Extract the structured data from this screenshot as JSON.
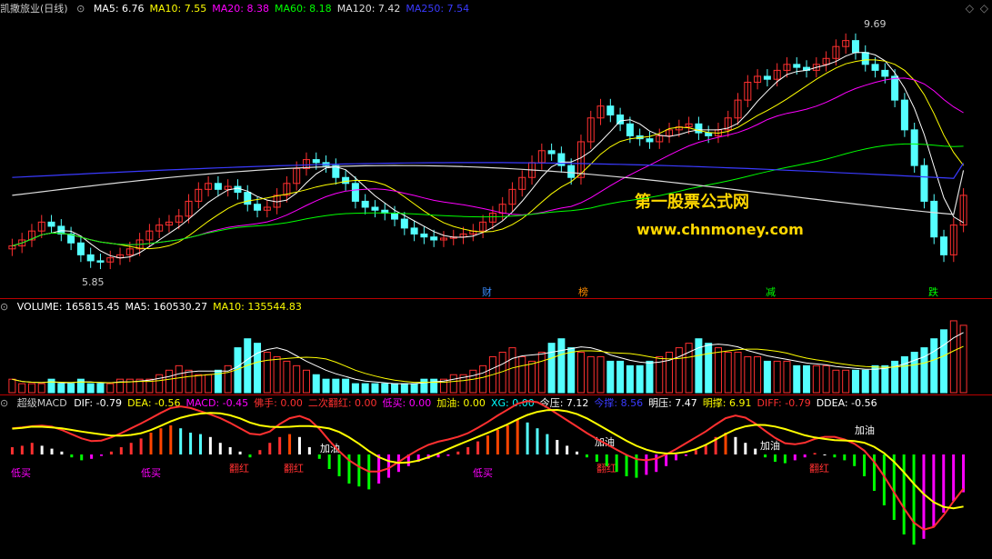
{
  "chart_data": [
    {
      "type": "candlestick",
      "title": "凯撒旅业(日线)",
      "indicators": [
        {
          "name": "MA5",
          "value": "6.76",
          "color": "#ffffff"
        },
        {
          "name": "MA10",
          "value": "7.55",
          "color": "#ffff00"
        },
        {
          "name": "MA20",
          "value": "8.38",
          "color": "#ff00ff"
        },
        {
          "name": "MA60",
          "value": "8.18",
          "color": "#00ff00"
        },
        {
          "name": "MA120",
          "value": "7.42",
          "color": "#dddddd"
        },
        {
          "name": "MA250",
          "value": "7.54",
          "color": "#3a3aff"
        }
      ],
      "high_label": "9.69",
      "low_label": "5.85",
      "event_markers": [
        {
          "text": "财",
          "color": "#3a8cff"
        },
        {
          "text": "榜",
          "color": "#ff8c00"
        },
        {
          "text": "减",
          "color": "#00ff00"
        },
        {
          "text": "跌",
          "color": "#00ff00"
        }
      ],
      "close": [
        6.15,
        6.25,
        6.4,
        6.55,
        6.48,
        6.35,
        6.2,
        6.0,
        5.9,
        5.88,
        5.95,
        6.0,
        6.1,
        6.25,
        6.4,
        6.5,
        6.55,
        6.65,
        6.9,
        7.1,
        7.2,
        7.1,
        7.15,
        7.05,
        6.85,
        6.75,
        6.8,
        7.0,
        7.2,
        7.45,
        7.6,
        7.55,
        7.5,
        7.3,
        7.2,
        6.9,
        6.8,
        6.75,
        6.7,
        6.6,
        6.45,
        6.35,
        6.3,
        6.25,
        6.28,
        6.3,
        6.35,
        6.4,
        6.55,
        6.7,
        6.85,
        7.1,
        7.3,
        7.55,
        7.75,
        7.7,
        7.5,
        7.3,
        7.9,
        8.3,
        8.5,
        8.35,
        8.2,
        8.0,
        7.95,
        7.9,
        8.0,
        8.1,
        8.15,
        8.2,
        8.05,
        8.0,
        8.1,
        8.3,
        8.6,
        8.9,
        9.0,
        8.95,
        9.1,
        9.2,
        9.15,
        9.1,
        9.2,
        9.3,
        9.5,
        9.6,
        9.4,
        9.2,
        9.1,
        9.0,
        8.6,
        8.1,
        7.5,
        6.9,
        6.3,
        6.0,
        6.5,
        7.0
      ]
    },
    {
      "type": "bar",
      "title": "VOLUME",
      "indicators": [
        {
          "name": "VOLUME",
          "value": "165815.45",
          "color": "#ffffff"
        },
        {
          "name": "MA5",
          "value": "160530.27",
          "color": "#ffffff"
        },
        {
          "name": "MA10",
          "value": "135544.83",
          "color": "#ffff00"
        }
      ],
      "values": [
        3,
        2,
        2,
        2,
        3,
        2,
        2,
        3,
        2,
        2,
        2,
        3,
        3,
        3,
        3,
        4,
        5,
        6,
        5,
        4,
        4,
        5,
        6,
        10,
        12,
        11,
        9,
        8,
        7,
        6,
        5,
        4,
        3,
        3,
        3,
        2,
        2,
        2,
        2,
        2,
        2,
        2,
        3,
        3,
        3,
        4,
        4,
        5,
        6,
        8,
        9,
        10,
        8,
        7,
        9,
        11,
        12,
        10,
        9,
        8,
        8,
        7,
        7,
        6,
        6,
        7,
        8,
        9,
        10,
        11,
        12,
        11,
        10,
        9,
        9,
        8,
        8,
        7,
        7,
        7,
        6,
        6,
        6,
        6,
        5,
        5,
        5,
        5,
        6,
        6,
        7,
        8,
        9,
        10,
        12,
        14,
        16,
        15
      ]
    },
    {
      "type": "bar",
      "title": "超级MACD",
      "indicators": [
        {
          "name": "DIF",
          "value": "-0.79",
          "color": "#ffffff"
        },
        {
          "name": "DEA",
          "value": "-0.56",
          "color": "#ffff00"
        },
        {
          "name": "MACD",
          "value": "-0.45",
          "color": "#ff00ff"
        },
        {
          "name": "佛手",
          "value": "0.00",
          "color": "#ff3030"
        },
        {
          "name": "二次翻红",
          "value": "0.00",
          "color": "#ff3030"
        },
        {
          "name": "低买",
          "value": "0.00",
          "color": "#ff00ff"
        },
        {
          "name": "加油",
          "value": "0.00",
          "color": "#ffff00"
        },
        {
          "name": "XG",
          "value": "0.00",
          "color": "#00ffff"
        },
        {
          "name": "今压",
          "value": "7.12",
          "color": "#ffffff"
        },
        {
          "name": "今撑",
          "value": "8.56",
          "color": "#3a3aff"
        },
        {
          "name": "明压",
          "value": "7.47",
          "color": "#ffffff"
        },
        {
          "name": "明撑",
          "value": "6.91",
          "color": "#ffff00"
        },
        {
          "name": "DIFF",
          "value": "-0.79",
          "color": "#ff3030"
        },
        {
          "name": "DDEA",
          "value": "-0.56",
          "color": "#ffffff"
        }
      ],
      "annotations": [
        {
          "text": "低买",
          "color": "#ff00ff"
        },
        {
          "text": "低买",
          "color": "#ff00ff"
        },
        {
          "text": "翻红",
          "color": "#ff3030"
        },
        {
          "text": "翻红",
          "color": "#ff3030"
        },
        {
          "text": "加油",
          "color": "#ffffff"
        },
        {
          "text": "低买",
          "color": "#ff00ff"
        },
        {
          "text": "加油",
          "color": "#ffffff"
        },
        {
          "text": "翻红",
          "color": "#ff3030"
        },
        {
          "text": "加油",
          "color": "#ffffff"
        },
        {
          "text": "翻红",
          "color": "#ff3030"
        },
        {
          "text": "加油",
          "color": "#ffffff"
        }
      ],
      "values": [
        0.05,
        0.06,
        0.08,
        0.06,
        0.04,
        0.02,
        -0.02,
        -0.04,
        -0.03,
        -0.01,
        0.02,
        0.05,
        0.08,
        0.11,
        0.15,
        0.18,
        0.2,
        0.18,
        0.15,
        0.14,
        0.12,
        0.08,
        0.05,
        0.02,
        -0.02,
        0.03,
        0.08,
        0.12,
        0.14,
        0.12,
        0.05,
        -0.03,
        -0.1,
        -0.15,
        -0.2,
        -0.22,
        -0.24,
        -0.2,
        -0.16,
        -0.12,
        -0.08,
        -0.05,
        -0.03,
        -0.02,
        -0.01,
        0.02,
        0.05,
        0.09,
        0.13,
        0.17,
        0.2,
        0.24,
        0.22,
        0.18,
        0.14,
        0.1,
        0.06,
        0.02,
        -0.02,
        -0.05,
        -0.08,
        -0.12,
        -0.15,
        -0.16,
        -0.14,
        -0.12,
        -0.08,
        -0.04,
        -0.01,
        0.03,
        0.07,
        0.12,
        0.15,
        0.12,
        0.08,
        0.04,
        -0.02,
        -0.05,
        -0.06,
        -0.04,
        -0.02,
        0.01,
        0.0,
        -0.02,
        -0.04,
        -0.08,
        -0.15,
        -0.25,
        -0.35,
        -0.45,
        -0.55,
        -0.62,
        -0.58,
        -0.5,
        -0.4,
        -0.32,
        -0.26
      ]
    }
  ],
  "watermark": {
    "line1": "第一股票公式网",
    "line2": "www.chnmoney.com"
  },
  "colors": {
    "up": "#ff3030",
    "down": "#54ffff",
    "background": "#000000",
    "separator": "#b00000"
  }
}
